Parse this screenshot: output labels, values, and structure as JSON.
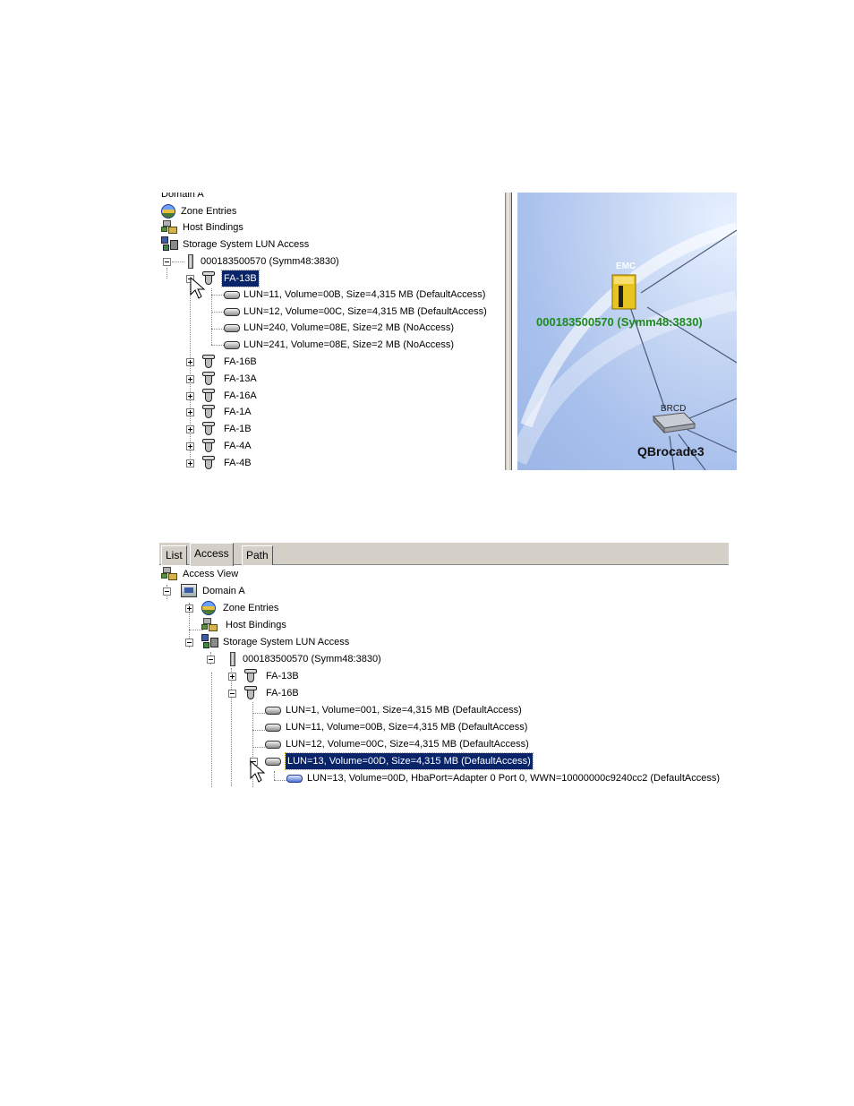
{
  "panel1": {
    "tree": {
      "domain_label": "Domain A",
      "zone_entries": "Zone Entries",
      "host_bindings": "Host Bindings",
      "storage_lun_access": "Storage System LUN Access",
      "storage_system": "000183500570 (Symm48:3830)",
      "selected_port": "FA-13B",
      "luns": [
        "LUN=11, Volume=00B, Size=4,315 MB (DefaultAccess)",
        "LUN=12, Volume=00C, Size=4,315 MB (DefaultAccess)",
        "LUN=240, Volume=08E, Size=2 MB (NoAccess)",
        "LUN=241, Volume=08E, Size=2 MB (NoAccess)"
      ],
      "ports": [
        "FA-16B",
        "FA-13A",
        "FA-16A",
        "FA-1A",
        "FA-1B",
        "FA-4A",
        "FA-4B"
      ]
    },
    "topology": {
      "storage_vendor": "EMC",
      "storage_caption": "000183500570 (Symm48:3830)",
      "switch_vendor": "BRCD",
      "switch_caption": "QBrocade3",
      "caption_color": "#1f8a1f"
    }
  },
  "panel2": {
    "tabs": [
      "List",
      "Access",
      "Path"
    ],
    "active_tab": "Access",
    "tree": {
      "root": "Access View",
      "domain": "Domain A",
      "zone_entries": "Zone Entries",
      "host_bindings": "Host Bindings",
      "storage_lun_access": "Storage System LUN Access",
      "storage_system": "000183500570 (Symm48:3830)",
      "port_collapsed": "FA-13B",
      "port_expanded": "FA-16B",
      "luns": [
        "LUN=1, Volume=001, Size=4,315 MB (DefaultAccess)",
        "LUN=11, Volume=00B, Size=4,315 MB (DefaultAccess)",
        "LUN=12, Volume=00C, Size=4,315 MB (DefaultAccess)"
      ],
      "selected_lun": "LUN=13, Volume=00D, Size=4,315 MB (DefaultAccess)",
      "binding": "LUN=13, Volume=00D, HbaPort=Adapter 0 Port 0, WWN=10000000c9240cc2 (DefaultAccess)"
    }
  },
  "colors": {
    "selection": "#0a246a",
    "tab_bg": "#d4d0c8"
  },
  "icons": [
    "lun-disk-icon",
    "fa-port-icon",
    "storage-system-icon",
    "zone-icon",
    "host-binding-icon",
    "domain-icon",
    "lun-access-icon",
    "mouse-cursor-icon",
    "emc-storage-icon",
    "brocade-switch-icon"
  ]
}
